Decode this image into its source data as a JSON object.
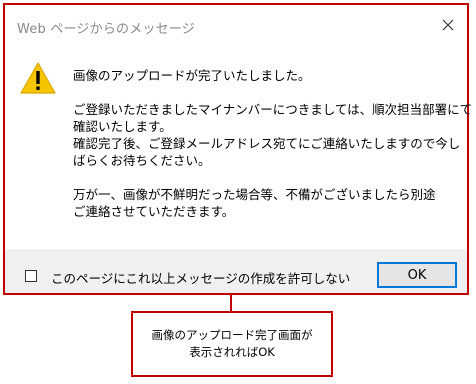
{
  "dialog": {
    "title": "Web ページからのメッセージ",
    "message_lines": [
      "画像のアップロードが完了いたしました。",
      "",
      "ご登録いただきましたマイナンバーにつきましては、順次担当部署にて",
      "確認いたします。",
      "確認完了後、ご登録メールアドレス宛てにご連絡いたしますので今し",
      "ばらくお待ちください。",
      "",
      " 万が一、画像が不鮮明だった場合等、不備がございましたら別途",
      "ご連絡させていただきます。"
    ],
    "checkbox_label": "このページにこれ以上メッセージの作成を許可しない",
    "checkbox_checked": false,
    "ok_label": "OK"
  },
  "callout": {
    "line1": "画像のアップロード完了画面が",
    "line2": "表示されればOK"
  },
  "colors": {
    "highlight_border": "#c00000",
    "ok_focus_border": "#0078d7",
    "warning_icon": "#f7c400",
    "title_text": "#888888",
    "footer_bg": "#f0f0f0"
  },
  "icons": {
    "warning": "warning-triangle-icon",
    "close": "close-icon"
  }
}
